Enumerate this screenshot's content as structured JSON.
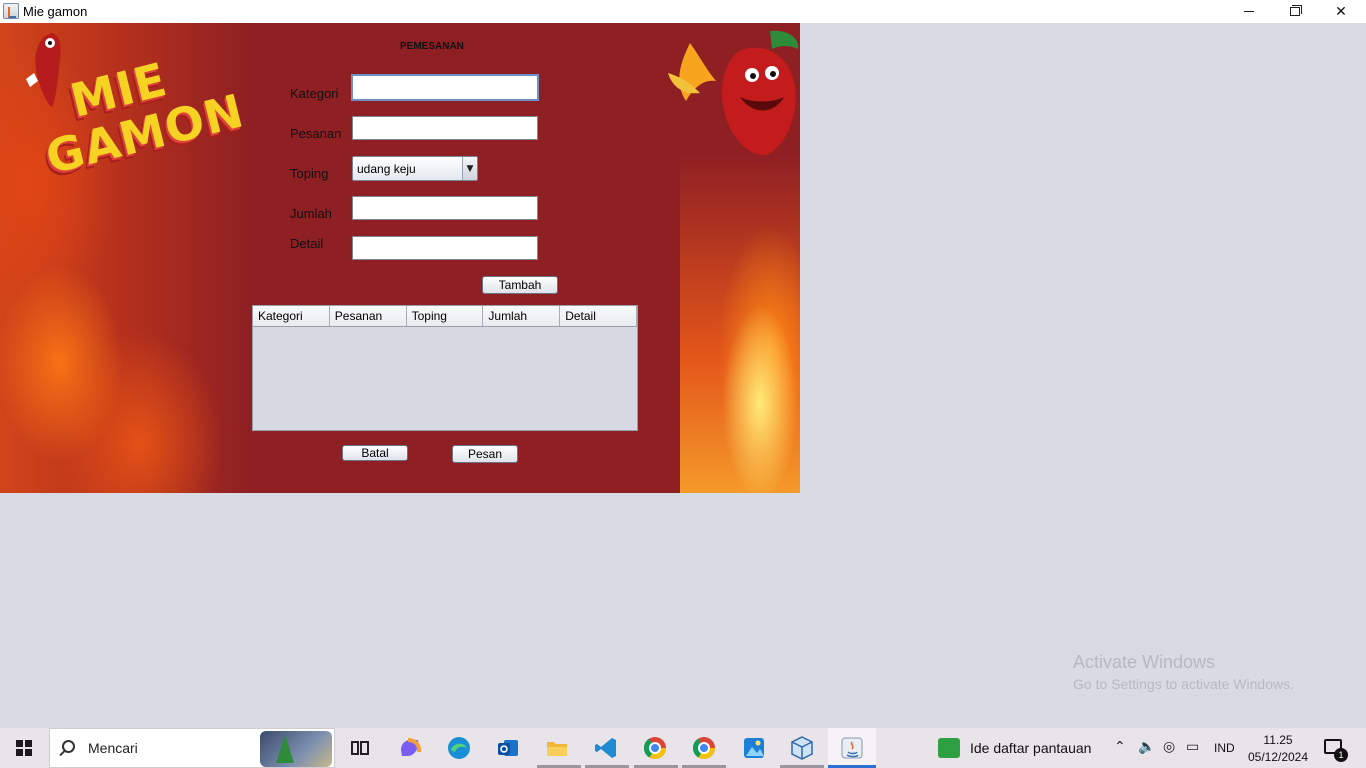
{
  "window": {
    "title": "Mie gamon"
  },
  "app": {
    "logo_line1": "MIE",
    "logo_line2": "GAMON",
    "heading": "PEMESANAN",
    "labels": {
      "kategori": "Kategori",
      "pesanan": "Pesanan",
      "toping": "Toping",
      "jumlah": "Jumlah",
      "detail": "Detail"
    },
    "fields": {
      "kategori": "",
      "pesanan": "",
      "jumlah": "",
      "detail": ""
    },
    "toping_selected": "udang keju",
    "buttons": {
      "tambah": "Tambah",
      "batal": "Batal",
      "pesan": "Pesan"
    },
    "table": {
      "columns": [
        "Kategori",
        "Pesanan",
        "Toping",
        "Jumlah",
        "Detail"
      ],
      "rows": []
    }
  },
  "watermark": {
    "line1": "Activate Windows",
    "line2": "Go to Settings to activate Windows."
  },
  "taskbar": {
    "search_placeholder": "Mencari",
    "news_text": "Ide daftar pantauan",
    "language": "IND",
    "time": "11.25",
    "date": "05/12/2024",
    "notification_count": "1",
    "pinned": [
      "task-view",
      "copilot",
      "edge",
      "outlook",
      "file-explorer",
      "vscode",
      "chrome",
      "chrome-profile",
      "photos",
      "virtualbox",
      "java"
    ]
  },
  "colors": {
    "app_background": "#8e1f23",
    "desktop": "#d8dbe3",
    "logo_yellow": "#f6d223"
  }
}
